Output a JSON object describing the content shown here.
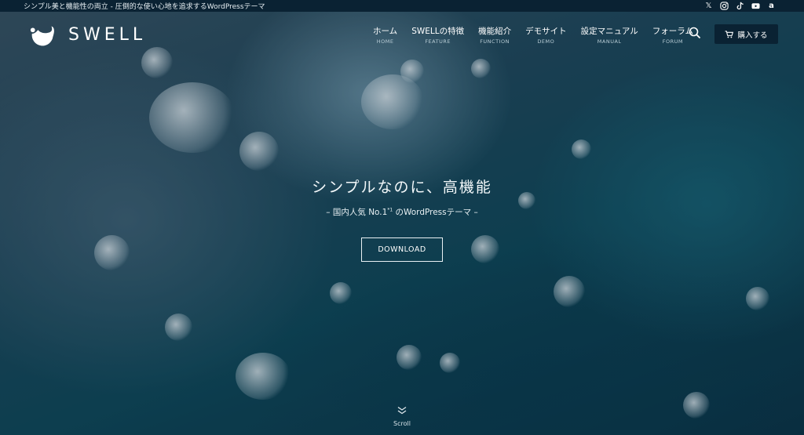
{
  "topbar": {
    "tagline": "シンプル美と機能性の両立 - 圧倒的な使い心地を追求するWordPressテーマ",
    "social_icons": [
      "x-icon",
      "instagram-icon",
      "tiktok-icon",
      "youtube-icon",
      "amazon-icon"
    ]
  },
  "header": {
    "logo_text": "SWELL",
    "nav": [
      {
        "ja": "ホーム",
        "en": "HOME"
      },
      {
        "ja": "SWELLの特徴",
        "en": "FEATURE"
      },
      {
        "ja": "機能紹介",
        "en": "FUNCTION"
      },
      {
        "ja": "デモサイト",
        "en": "DEMO"
      },
      {
        "ja": "設定マニュアル",
        "en": "MANUAL"
      },
      {
        "ja": "フォーラム",
        "en": "FORUM"
      }
    ],
    "buy_label": "購入する"
  },
  "hero": {
    "title": "シンプルなのに、高機能",
    "subtitle_before": "– 国内人気 No.1",
    "subtitle_sup": "*1",
    "subtitle_after": " のWordPressテーマ –",
    "download_label": "DOWNLOAD",
    "scroll_label": "Scroll"
  },
  "colors": {
    "topbar_bg": "#0a2233",
    "buy_button_bg": "#0a2233",
    "hero_ocean": "#0f4a5c"
  }
}
